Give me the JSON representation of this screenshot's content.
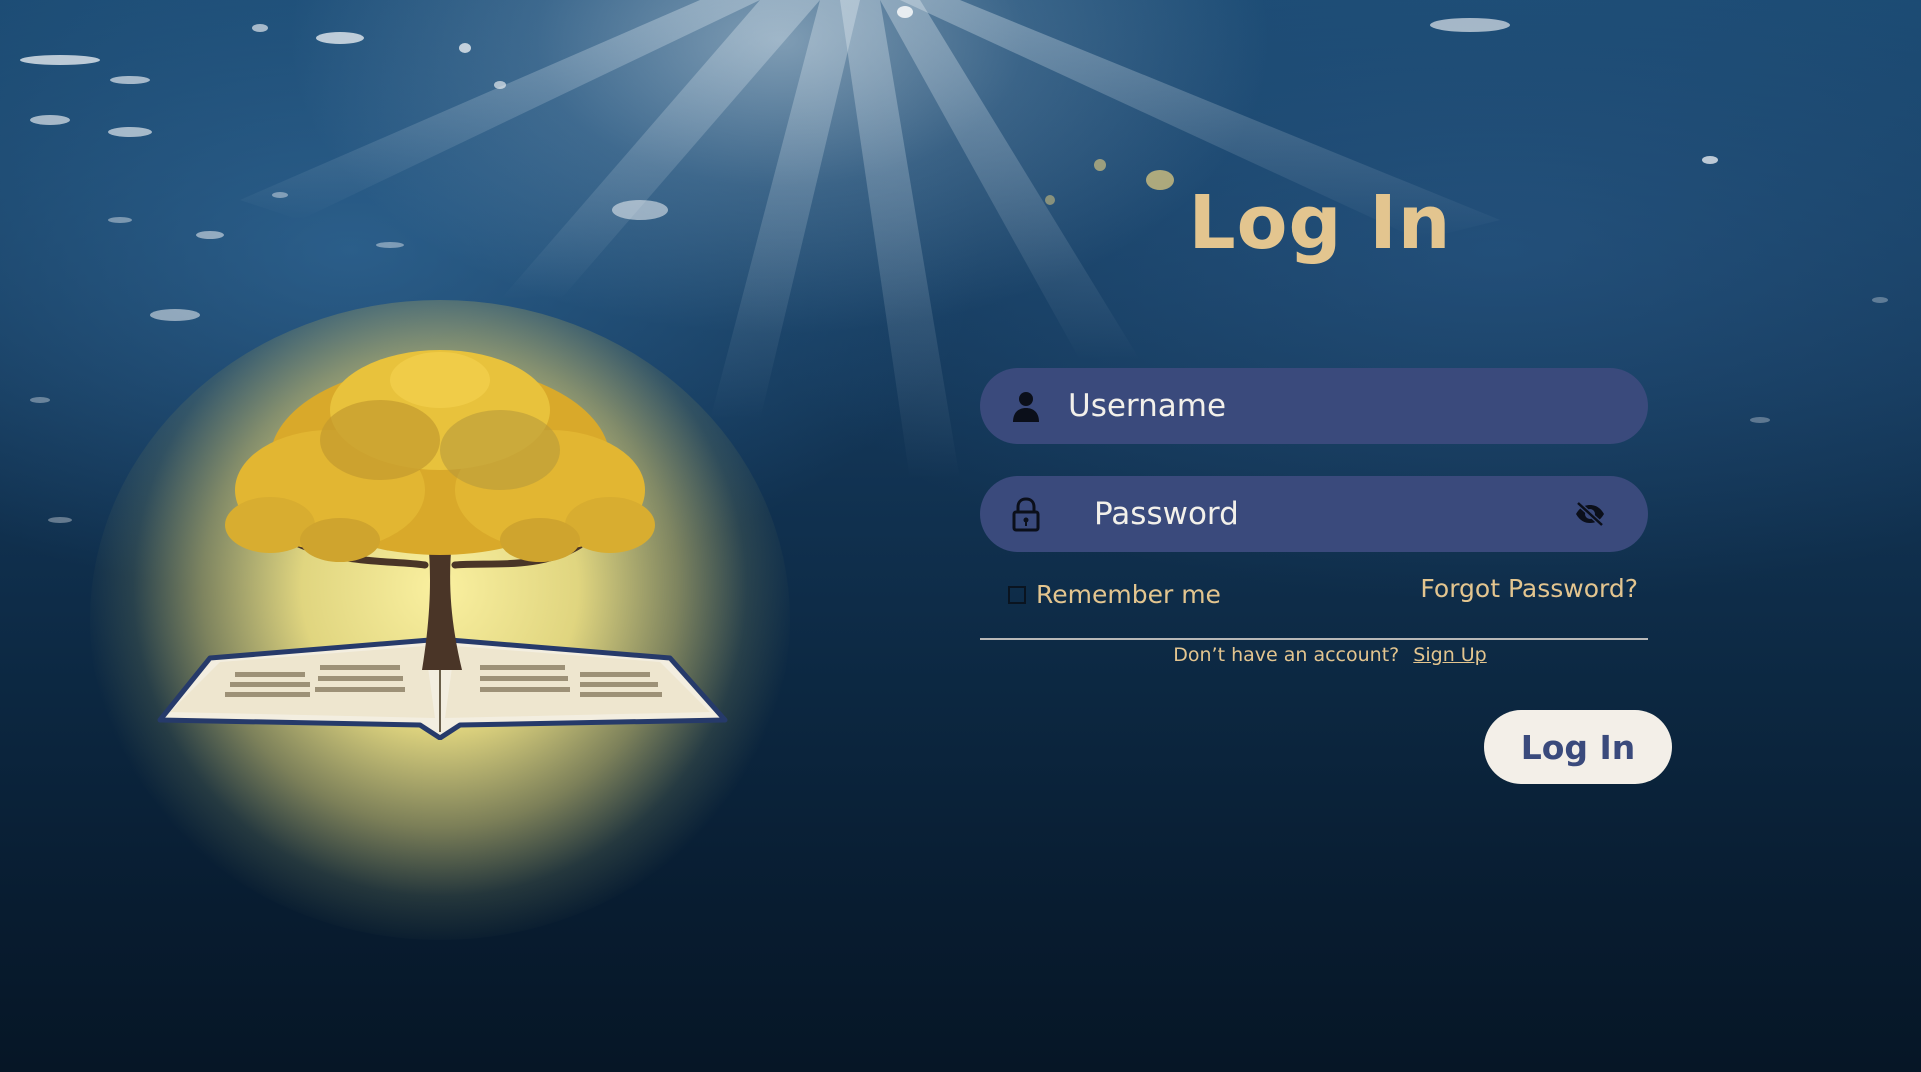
{
  "page": {
    "title": "Log In"
  },
  "form": {
    "username": {
      "value": "",
      "placeholder": "Username",
      "icon": "user-icon"
    },
    "password": {
      "value": "",
      "placeholder": "Password",
      "icon": "lock-icon",
      "toggle_icon": "eye-slash-icon"
    },
    "remember_me": {
      "label": "Remember me",
      "checked": false
    },
    "forgot_password_label": "Forgot Password?",
    "signup_prompt": "Don’t have an account?",
    "signup_label": "Sign Up",
    "submit_label": "Log In"
  },
  "illustration": {
    "icon": "tree-on-open-book-illustration"
  },
  "colors": {
    "accent_gold": "#e3c58f",
    "field_background": "#3a4a7c",
    "button_background": "#f3efe8",
    "button_text": "#3a4a7c"
  }
}
